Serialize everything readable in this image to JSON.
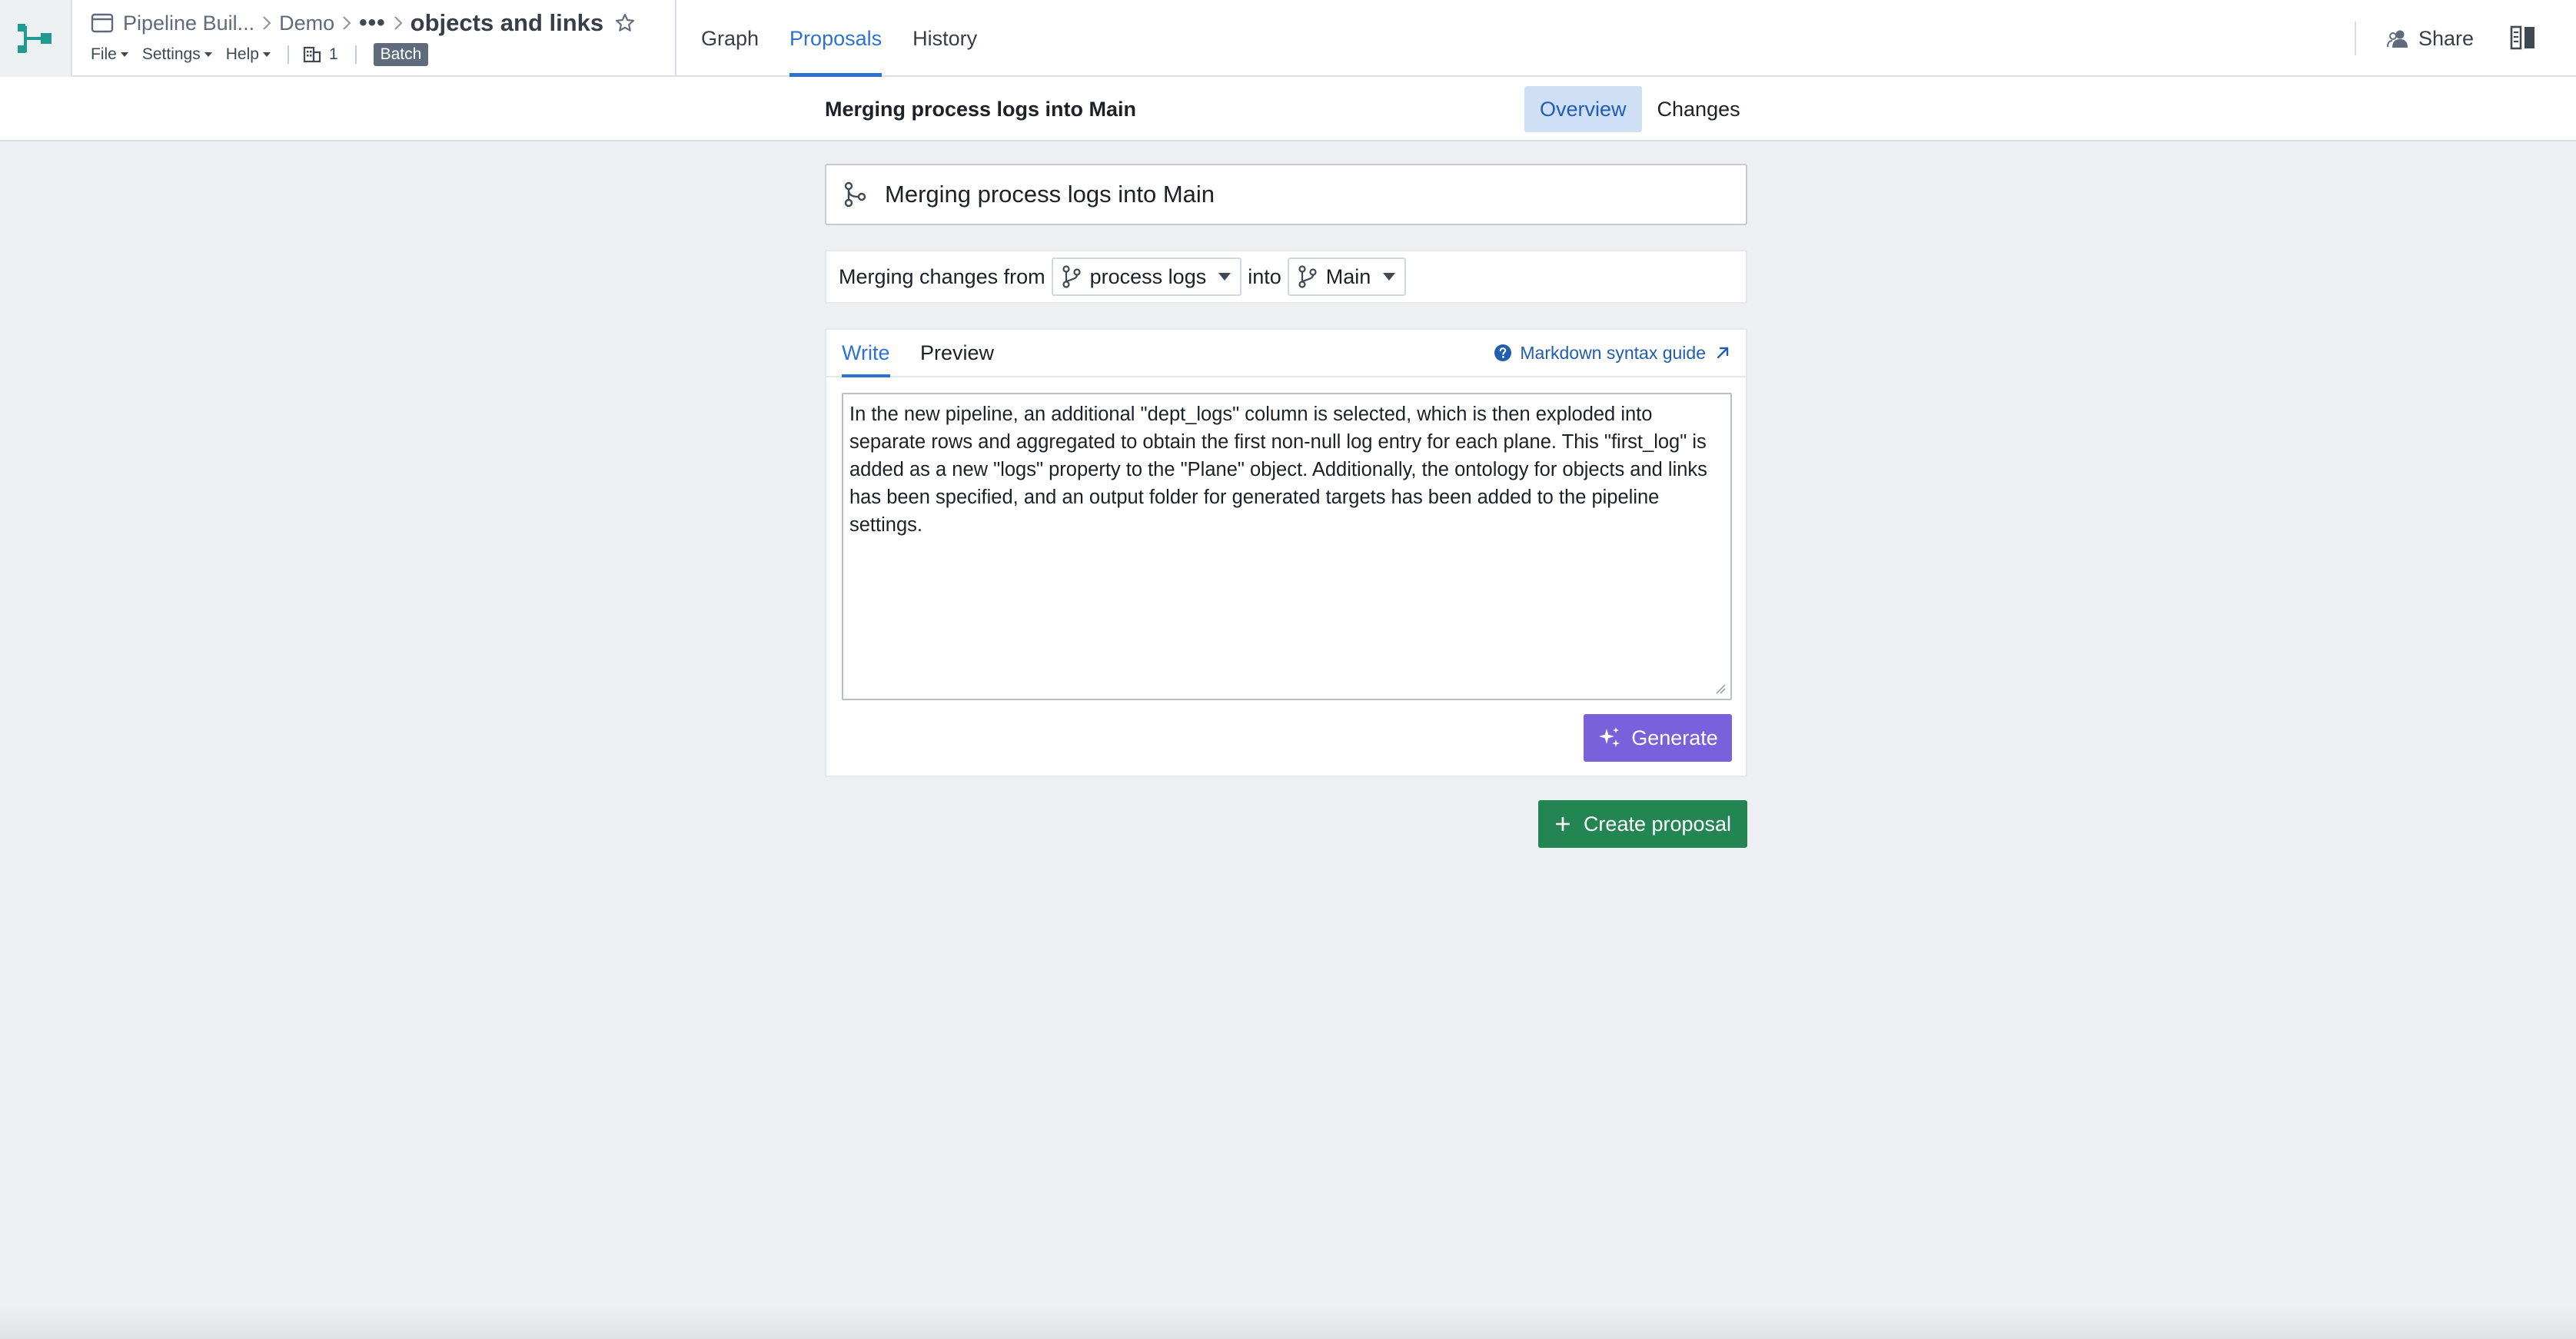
{
  "header": {
    "logo_icon": "pipeline-builder-logo-icon",
    "breadcrumbs": [
      "Pipeline Buil...",
      "Demo"
    ],
    "breadcrumb_more": "•••",
    "title": "objects and links",
    "menus": [
      "File",
      "Settings",
      "Help"
    ],
    "count": "1",
    "badge": "Batch",
    "tabs": [
      "Graph",
      "Proposals",
      "History"
    ],
    "active_tab": "Proposals",
    "share_label": "Share"
  },
  "subheader": {
    "title": "Merging process logs into Main",
    "segments": [
      "Overview",
      "Changes"
    ],
    "active_segment": "Overview"
  },
  "proposal": {
    "title_value": "Merging process logs into Main",
    "merge_prefix": "Merging changes from",
    "source_branch": "process logs",
    "merge_infix": "into",
    "target_branch": "Main",
    "editor_tabs": [
      "Write",
      "Preview"
    ],
    "active_editor_tab": "Write",
    "markdown_guide": "Markdown syntax guide",
    "description": "In the new pipeline, an additional \"dept_logs\" column is selected, which is then exploded into separate rows and aggregated to obtain the first non-null log entry for each plane. This \"first_log\" is added as a new \"logs\" property to the \"Plane\" object. Additionally, the ontology for objects and links has been specified, and an output folder for generated targets has been added to the pipeline settings.",
    "generate_label": "Generate",
    "create_label": "Create proposal"
  },
  "colors": {
    "accent": "#2d72d2",
    "generate": "#7961db",
    "create": "#238551",
    "logo": "#1f9c8f",
    "background": "#edeff2"
  }
}
